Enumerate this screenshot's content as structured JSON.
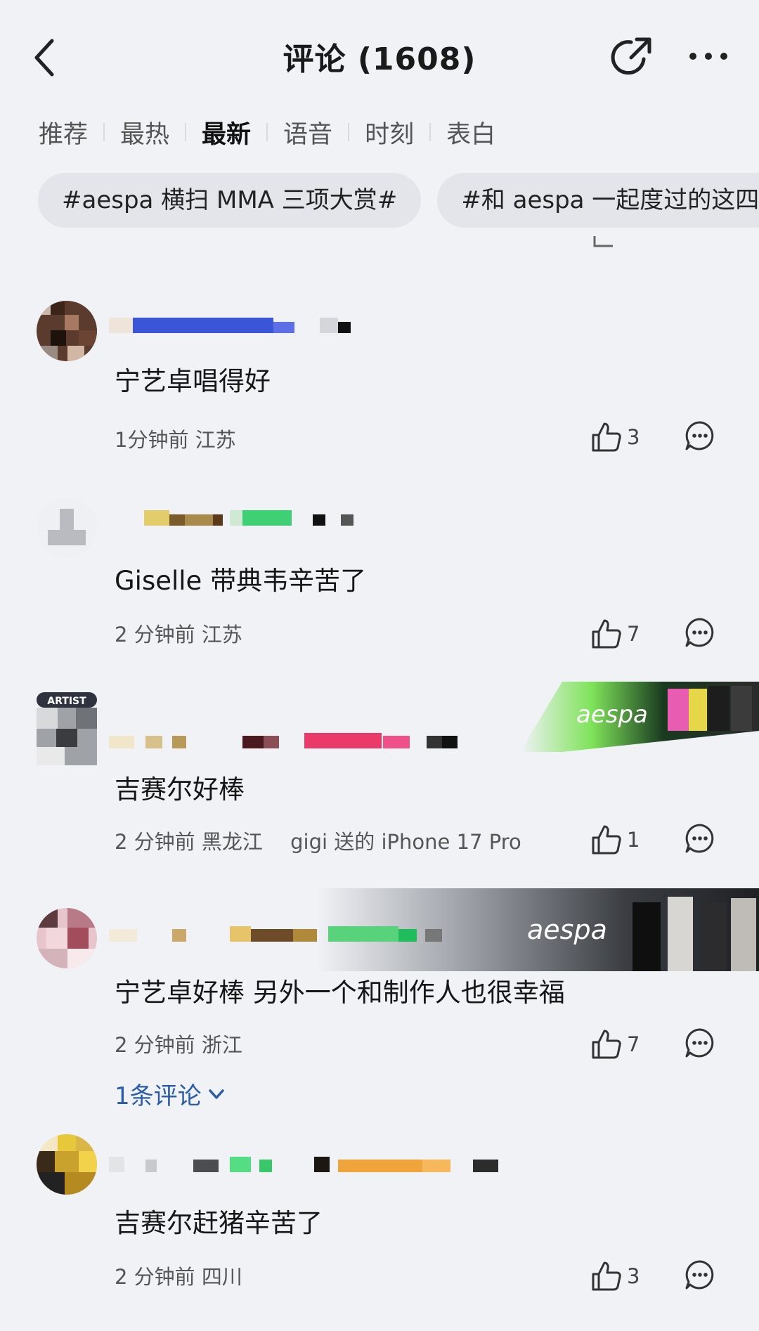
{
  "header": {
    "title": "评论 (1608)"
  },
  "tabs": [
    "推荐",
    "最热",
    "最新",
    "语音",
    "时刻",
    "表白"
  ],
  "active_tab": "最新",
  "topics": [
    "#aespa 横扫 MMA 三项大赏#",
    "#和 aespa 一起度过的这四"
  ],
  "comments": [
    {
      "content": "宁艺卓唱得好",
      "time": "1分钟前",
      "location": "江苏",
      "device": "",
      "likes": "3"
    },
    {
      "content": "Giselle 带典韦辛苦了",
      "time": "2 分钟前",
      "location": "江苏",
      "device": "",
      "likes": "7"
    },
    {
      "content": "吉赛尔好棒",
      "time": "2 分钟前",
      "location": "黑龙江",
      "device": "gigi 送的 iPhone 17 Pro",
      "likes": "1",
      "badge": "ARTIST"
    },
    {
      "content": "宁艺卓好棒 另外一个和制作人也很幸福",
      "time": "2 分钟前",
      "location": "浙江",
      "device": "",
      "likes": "7",
      "replies": "1条评论"
    },
    {
      "content": "吉赛尔赶猪辛苦了",
      "time": "2 分钟前",
      "location": "四川",
      "device": "",
      "likes": "3"
    }
  ],
  "banner_text": [
    "aespa",
    "aespa"
  ],
  "colors": {
    "background": "#f0f2f6",
    "link": "#2a5ca8",
    "chip": "#e3e5ea"
  },
  "icons": [
    "back-icon",
    "share-icon",
    "more-icon",
    "like-icon",
    "reply-icon",
    "chevron-down-icon"
  ]
}
